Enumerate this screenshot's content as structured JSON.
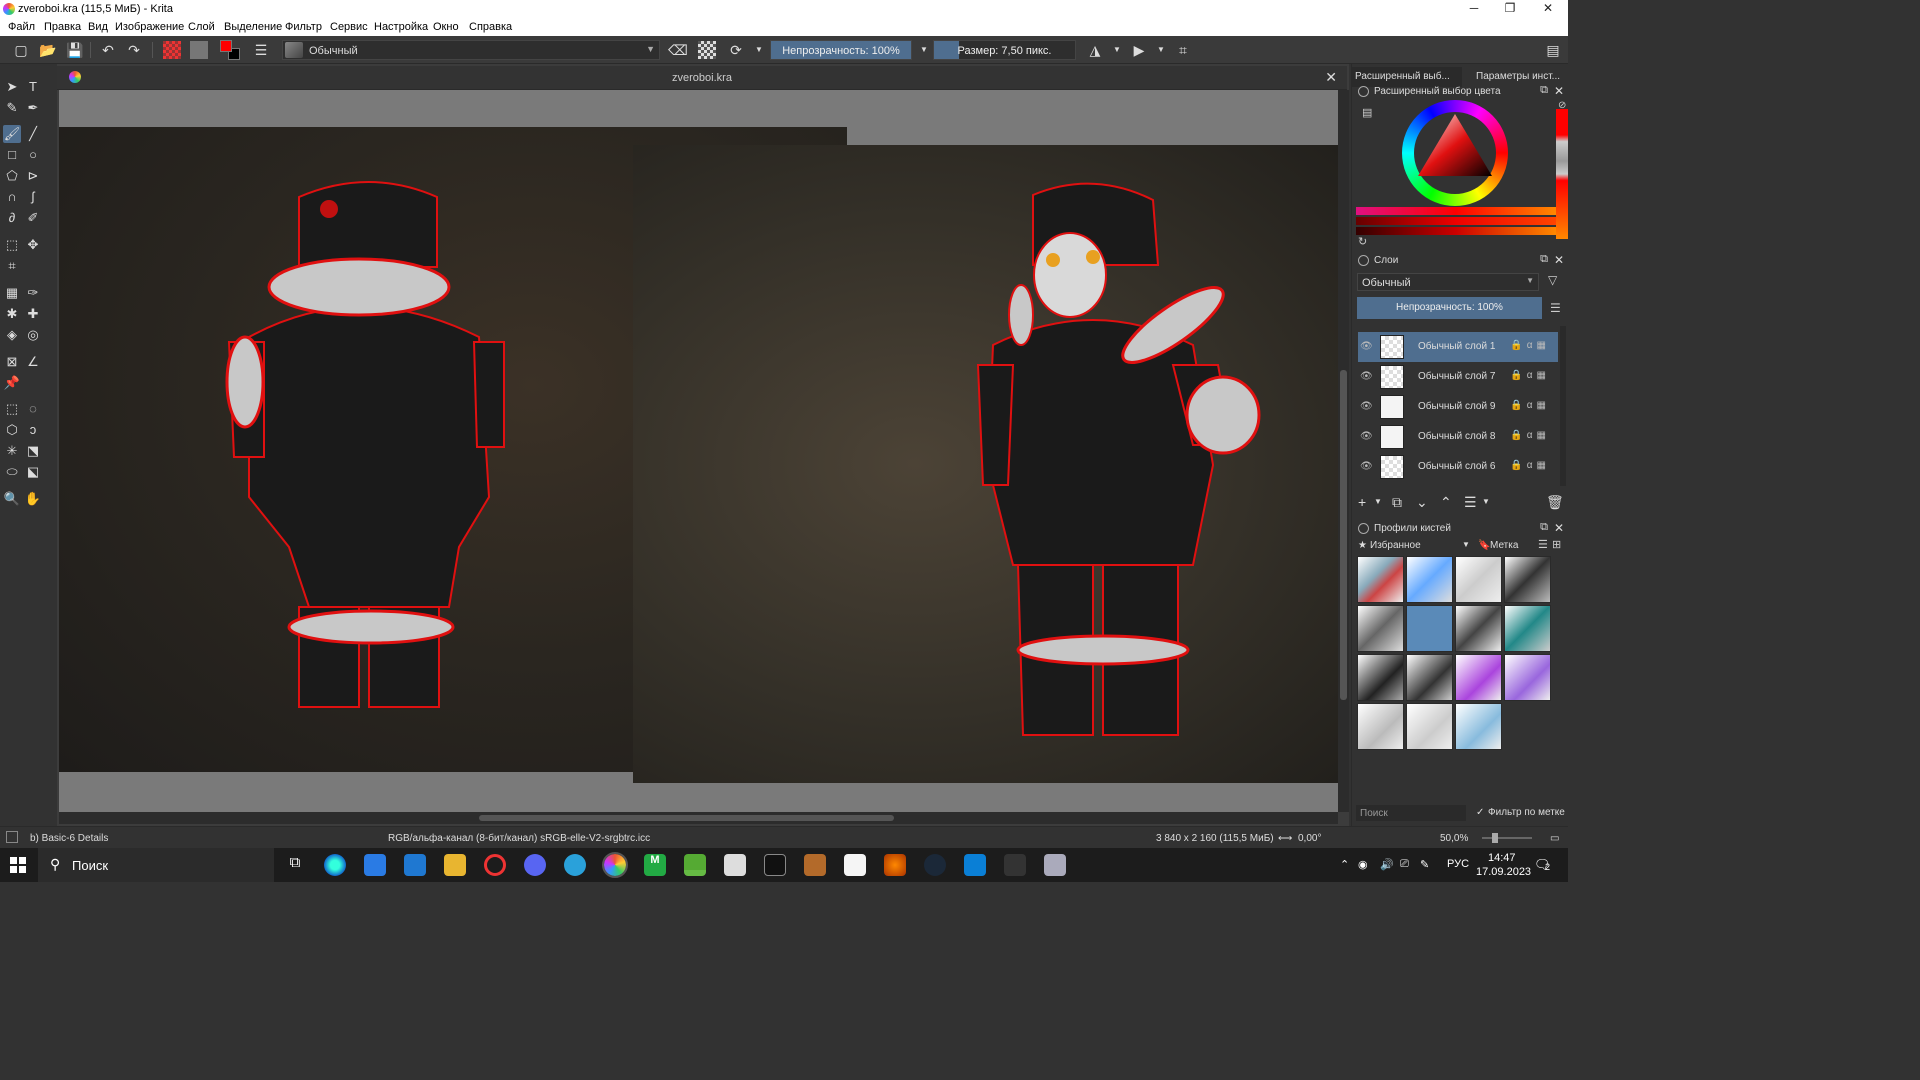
{
  "window": {
    "title": "zveroboi.kra (115,5 МиБ)  - Krita",
    "min_glyph": "─",
    "max_glyph": "❐",
    "close_glyph": "✕"
  },
  "menu": [
    "Файл",
    "Правка",
    "Вид",
    "Изображение",
    "Слой",
    "Выделение",
    "Фильтр",
    "Сервис",
    "Настройка",
    "Окно",
    "Справка"
  ],
  "toolbar": {
    "blend_mode": "Обычный",
    "opacity_label": "Непрозрачность: 100%",
    "opacity_value": 1.0,
    "size_label": "Размер: 7,50 пикс.",
    "fg_color": "#ff0000",
    "bg_color": "#000000"
  },
  "document": {
    "tab_name": "zveroboi.kra"
  },
  "right_panel": {
    "tabs": [
      "Расширенный выб...",
      "Параметры инст..."
    ],
    "color_selector_title": "Расширенный выбор цвета",
    "layers_title": "Слои",
    "layers_blend": "Обычный",
    "layers_opacity": "Непрозрачность:  100%",
    "layers": [
      {
        "name": "Обычный слой 1",
        "selected": true
      },
      {
        "name": "Обычный слой 7",
        "selected": false
      },
      {
        "name": "Обычный слой 9",
        "selected": false
      },
      {
        "name": "Обычный слой 8",
        "selected": false
      },
      {
        "name": "Обычный слой 6",
        "selected": false
      }
    ],
    "brush_presets_title": "Профили кистей",
    "brush_tag": "Избранное",
    "brush_tag_label": "Метка",
    "search_placeholder": "Поиск",
    "filter_by_tag": "Фильтр по метке"
  },
  "status": {
    "brush_name": "b) Basic-6 Details",
    "color_space": "RGB/альфа-канал (8-бит/канал)  sRGB-elle-V2-srgbtrc.icc",
    "image_size": "3 840 x 2 160 (115,5 МиБ)",
    "rotation": "0,00°",
    "zoom": "50,0%"
  },
  "taskbar": {
    "search_label": "Поиск",
    "language": "РУС",
    "time": "14:47",
    "date": "17.09.2023",
    "notifications": "2"
  },
  "colors": {
    "accent": "#4f6e8f",
    "panel_bg": "#323232"
  }
}
